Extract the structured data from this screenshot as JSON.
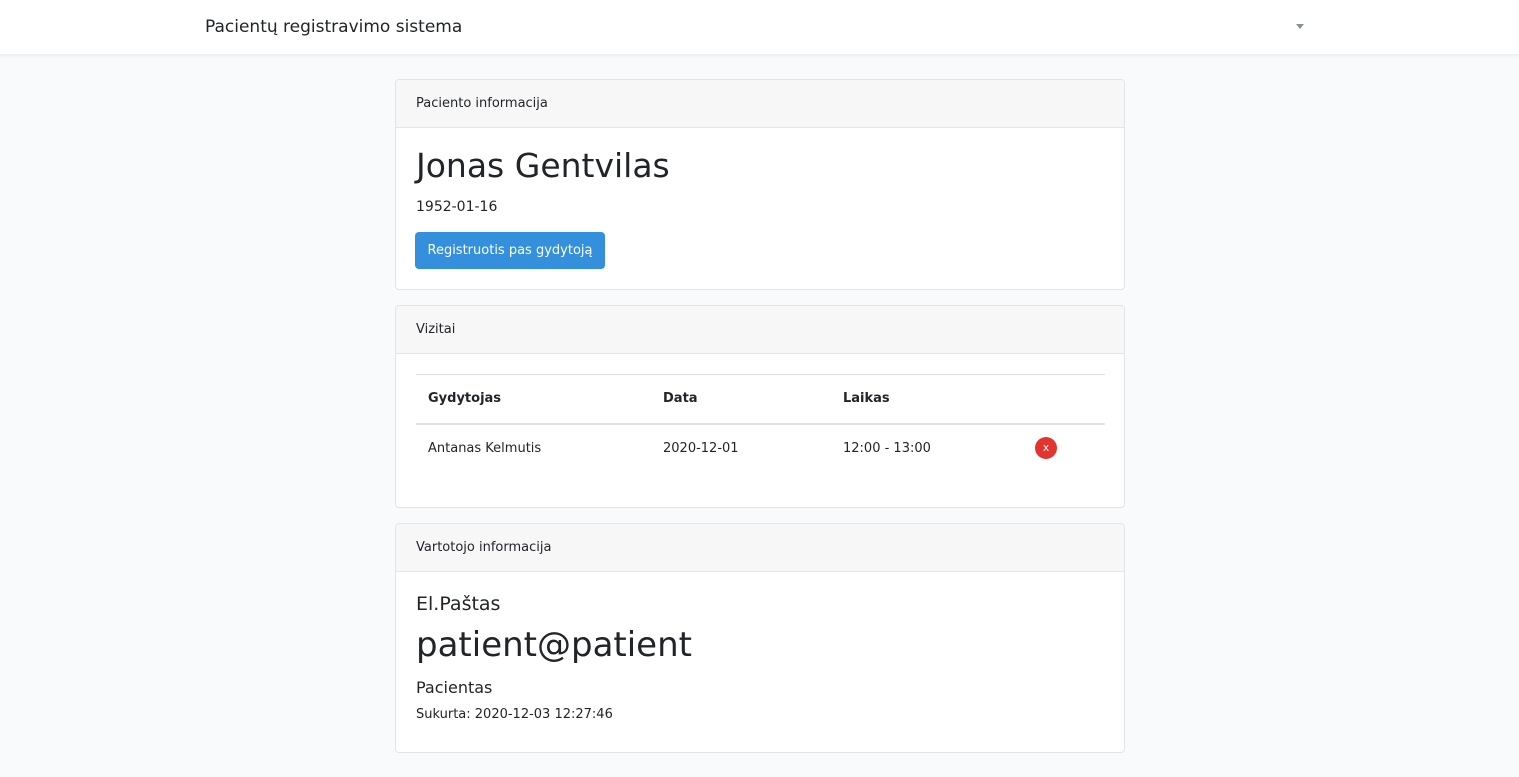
{
  "navbar": {
    "brand": "Pacientų registravimo sistema",
    "dropdown_icon": "caret-down-icon"
  },
  "patient_card": {
    "header": "Paciento informacija",
    "name": "Jonas Gentvilas",
    "birth_date": "1952-01-16",
    "register_button": "Registruotis pas gydytoją"
  },
  "visits_card": {
    "header": "Vizitai",
    "columns": [
      "Gydytojas",
      "Data",
      "Laikas",
      ""
    ],
    "rows": [
      {
        "doctor": "Antanas Kelmutis",
        "date": "2020-12-01",
        "time": "12:00 - 13:00",
        "delete_label": "x"
      }
    ]
  },
  "user_card": {
    "header": "Vartotojo informacija",
    "email_label": "El.Paštas",
    "email": "patient@patient",
    "role": "Pacientas",
    "created": "Sukurta: 2020-12-03 12:27:46"
  },
  "colors": {
    "primary": "#3490dc",
    "danger": "#e3342f",
    "background": "#f8fafc"
  }
}
